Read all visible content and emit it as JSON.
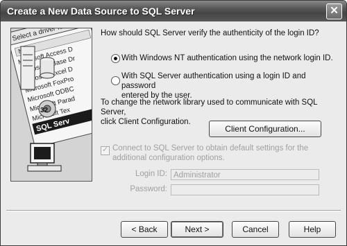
{
  "window": {
    "title": "Create a New Data Source to SQL Server",
    "close_glyph": "✕"
  },
  "wizard_image": {
    "header_text": "Select a driver fo",
    "column_label": "Name",
    "list_items": [
      "Microsoft Access D",
      "Microsoft dBase Dr",
      "Microsoft Excel D",
      "Microsoft FoxPro",
      "Microsoft ODBC",
      "Microsoft Parad",
      "Microsoft Tex"
    ],
    "selected_item": "SQL Serv",
    "badge_text": "32"
  },
  "auth": {
    "question": "How should SQL Server verify the authenticity of the login ID?",
    "option_nt": "With Windows NT authentication using the network login ID.",
    "option_sql_line1": "With SQL Server authentication using a login ID and password",
    "option_sql_line2": "entered by the user.",
    "selected": "nt"
  },
  "network": {
    "text_line1": "To change the network library used to communicate with SQL Server,",
    "text_line2": "click Client Configuration.",
    "client_config_button": "Client Configuration..."
  },
  "connect": {
    "checkbox_line1": "Connect to SQL Server to obtain default settings for the",
    "checkbox_line2": "additional configuration options.",
    "checked": true,
    "login_label": "Login ID:",
    "login_value": "Administrator",
    "password_label": "Password:",
    "password_value": ""
  },
  "buttons": {
    "back": "< Back",
    "next": "Next >",
    "cancel": "Cancel",
    "help": "Help"
  }
}
